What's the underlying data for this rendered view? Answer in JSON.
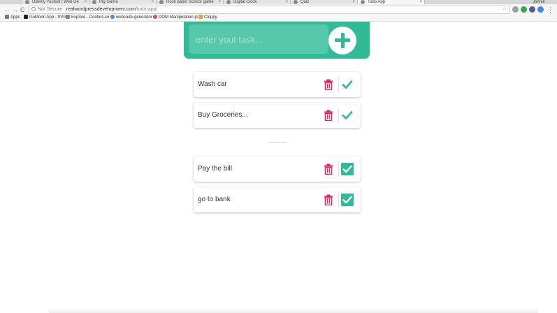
{
  "browser": {
    "tabs": [
      {
        "title": "Udemy Youtool | Web De"
      },
      {
        "title": "Pig Game"
      },
      {
        "title": "Rock paper scissor game"
      },
      {
        "title": "Digital Clock"
      },
      {
        "title": "Quiz"
      },
      {
        "title": "Todo App"
      }
    ],
    "profile_name": "Jonnie",
    "nav": {
      "back": "←",
      "forward": "→",
      "reload": "C"
    },
    "address": {
      "security": "Not Secure",
      "host": "realwordpressdevelopment.com",
      "path": "/todo-app/"
    },
    "star": "☆",
    "bookmarks": [
      {
        "label": "Apps",
        "color": "#7a7a7a"
      },
      {
        "label": "IcoMoon App - SVG",
        "color": "#222222"
      },
      {
        "label": "Explore - Coolors.co",
        "color": "#888888"
      },
      {
        "label": "webcode-generator",
        "color": "#4a90d9"
      },
      {
        "label": "DOM Manipulation-js",
        "color": "#d9534f"
      },
      {
        "label": "Cloppy",
        "color": "#e8a23a"
      }
    ]
  },
  "app": {
    "accent_color": "#2fbb96",
    "delete_color": "#e0245e",
    "input_placeholder": "enter yout task...",
    "add_icon": "plus-icon",
    "todo": [
      {
        "text": "Wash car"
      },
      {
        "text": "Buy Groceries..."
      }
    ],
    "completed": [
      {
        "text": "Pay the bill"
      },
      {
        "text": "go to bank"
      }
    ]
  }
}
